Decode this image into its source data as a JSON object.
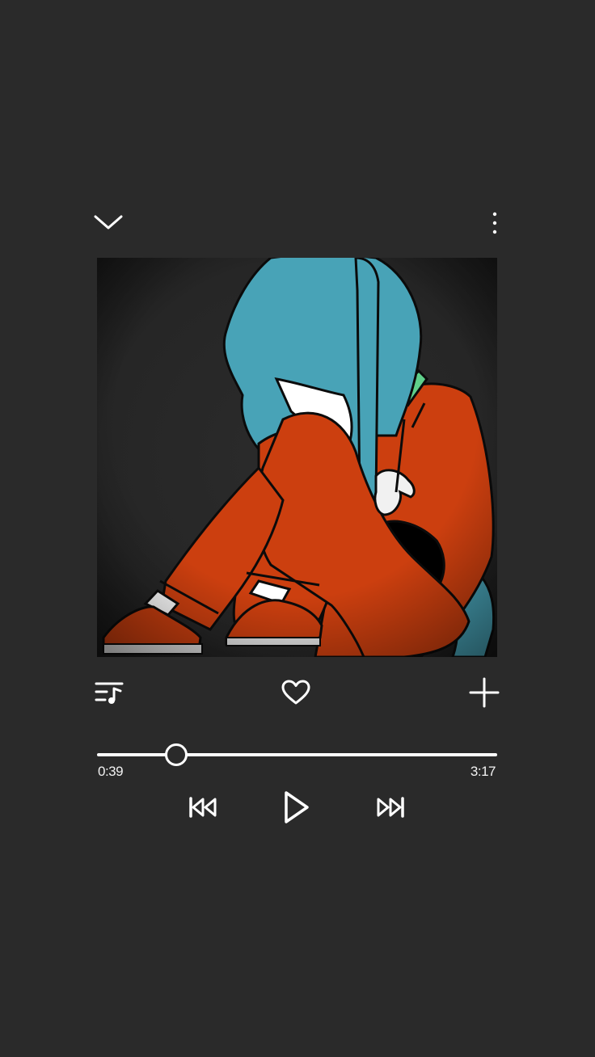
{
  "player": {
    "elapsed": "0:39",
    "duration": "3:17",
    "progress_fraction": 0.198
  },
  "colors": {
    "background": "#2a2a2a",
    "foreground": "#ffffff",
    "art_hair": "#48a3b7",
    "art_clothes": "#cc3f0f"
  },
  "icons": {
    "collapse": "chevron-down-icon",
    "more": "more-vertical-icon",
    "queue": "queue-music-icon",
    "like": "heart-icon",
    "add": "plus-icon",
    "previous": "skip-previous-icon",
    "play": "play-icon",
    "next": "skip-next-icon"
  }
}
